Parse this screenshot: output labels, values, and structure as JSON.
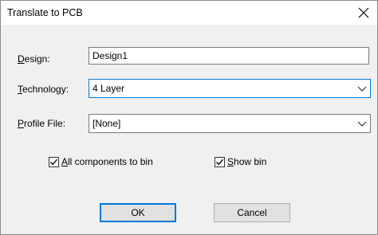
{
  "dialog": {
    "title": "Translate to PCB",
    "close_glyph": "✕"
  },
  "fields": {
    "design": {
      "label_prefix": "",
      "label_accel": "D",
      "label_rest": "esign:",
      "value": "Design1"
    },
    "technology": {
      "label_prefix": "",
      "label_accel": "T",
      "label_rest": "echnology:",
      "value": "4 Layer"
    },
    "profile": {
      "label_prefix": "",
      "label_accel": "P",
      "label_rest": "rofile File:",
      "value": "[None]"
    }
  },
  "options": {
    "all_components": {
      "label_accel": "A",
      "label_rest": "ll components to bin",
      "checked": true
    },
    "show_bin": {
      "label_accel": "S",
      "label_rest": "how bin",
      "checked": true
    }
  },
  "buttons": {
    "ok_label": "OK",
    "cancel_label": "Cancel"
  },
  "icons": {
    "close": "close-icon",
    "chevron": "chevron-down-icon",
    "check": "checkmark-icon"
  },
  "colors": {
    "focus_border": "#0078d7",
    "dialog_bg": "#f0f0f0",
    "button_bg": "#e1e1e1"
  }
}
